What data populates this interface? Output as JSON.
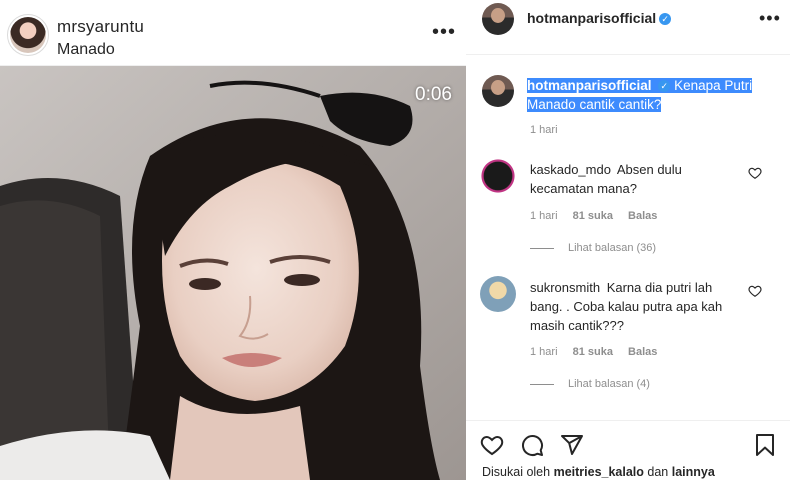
{
  "post": {
    "username": "mrsyaruntu",
    "location": "Manado",
    "more_icon": "•••",
    "video_timer": "0:06"
  },
  "panel": {
    "account": "hotmanparisofficial",
    "verified_icon": "✓",
    "more_icon": "•••"
  },
  "caption": {
    "username": "hotmanparisofficial",
    "text": "Kenapa Putri Manado cantik cantik?",
    "time": "1 hari"
  },
  "comments": [
    {
      "username": "kaskado_mdo",
      "text": "Absen dulu kecamatan mana?",
      "time": "1 hari",
      "likes": "81 suka",
      "reply_label": "Balas",
      "view_replies": "Lihat balasan (36)"
    },
    {
      "username": "sukronsmith",
      "text": "Karna dia putri lah bang. . Coba kalau putra apa kah masih cantik???",
      "time": "1 hari",
      "likes": "81 suka",
      "reply_label": "Balas",
      "view_replies": "Lihat balasan (4)"
    }
  ],
  "footer": {
    "liked_prefix": "Disukai oleh",
    "liked_user": "meitries_kalalo",
    "liked_join": "dan",
    "liked_others": "lainnya"
  },
  "icons": {
    "like": "heart-icon",
    "comment": "comment-icon",
    "share": "share-icon",
    "save": "bookmark-icon"
  }
}
